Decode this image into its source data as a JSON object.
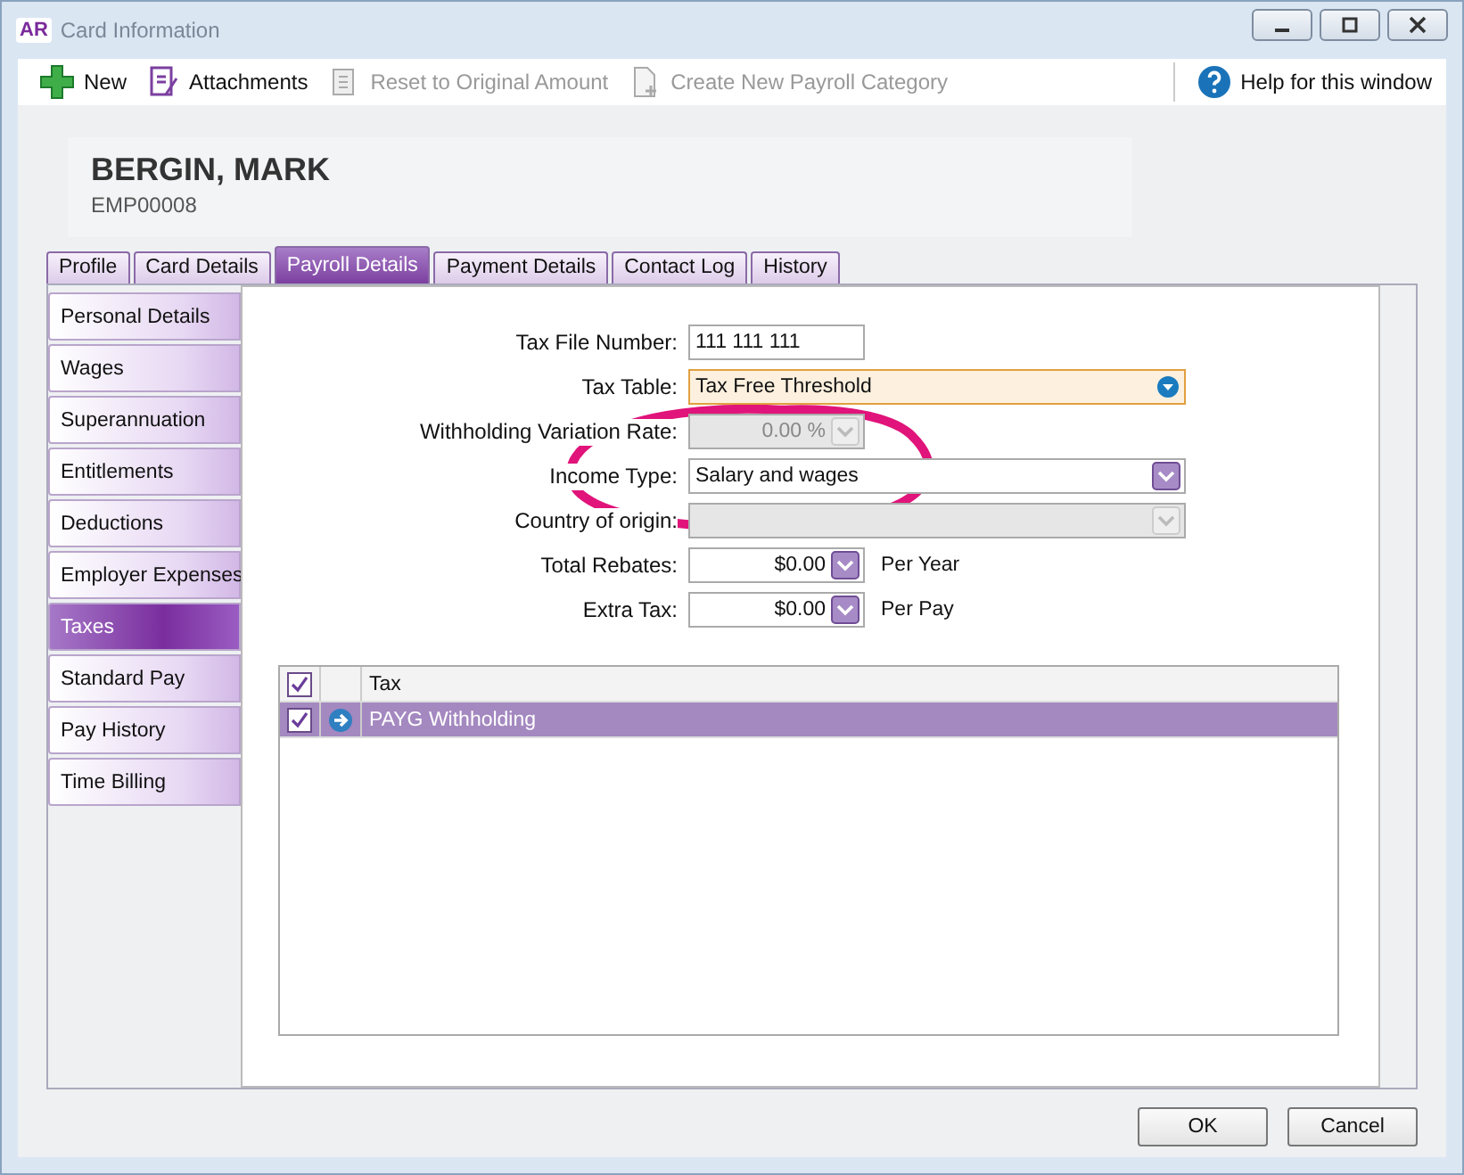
{
  "window": {
    "badge": "AR",
    "title": "Card Information"
  },
  "toolbar": [
    {
      "kind": "new",
      "label": "New",
      "disabled": false
    },
    {
      "kind": "attach",
      "label": "Attachments",
      "disabled": false
    },
    {
      "kind": "reset",
      "label": "Reset to Original Amount",
      "disabled": true
    },
    {
      "kind": "create",
      "label": "Create New Payroll Category",
      "disabled": true
    }
  ],
  "help": "Help for this window",
  "card": {
    "name": "BERGIN, MARK",
    "id": "EMP00008"
  },
  "tabs": [
    {
      "label": "Profile",
      "selected": false
    },
    {
      "label": "Card Details",
      "selected": false
    },
    {
      "label": "Payroll Details",
      "selected": true
    },
    {
      "label": "Payment Details",
      "selected": false
    },
    {
      "label": "Contact Log",
      "selected": false
    },
    {
      "label": "History",
      "selected": false
    }
  ],
  "sidebar": [
    {
      "label": "Personal Details",
      "selected": false
    },
    {
      "label": "Wages",
      "selected": false
    },
    {
      "label": "Superannuation",
      "selected": false
    },
    {
      "label": "Entitlements",
      "selected": false
    },
    {
      "label": "Deductions",
      "selected": false
    },
    {
      "label": "Employer Expenses",
      "selected": false
    },
    {
      "label": "Taxes",
      "selected": true
    },
    {
      "label": "Standard Pay",
      "selected": false
    },
    {
      "label": "Pay History",
      "selected": false
    },
    {
      "label": "Time Billing",
      "selected": false
    }
  ],
  "form": [
    {
      "kind": "text",
      "label": "Tax File Number:",
      "value": "111 111 111"
    },
    {
      "kind": "combo",
      "label": "Tax Table:",
      "value": "Tax Free Threshold",
      "focused": true,
      "disabled": false
    },
    {
      "kind": "amount",
      "label": "Withholding Variation Rate:",
      "value": "0.00 %",
      "disabled": true
    },
    {
      "kind": "combo",
      "label": "Income Type:",
      "value": "Salary and wages",
      "focused": false,
      "disabled": false
    },
    {
      "kind": "combo",
      "label": "Country of origin:",
      "focused": false,
      "disabled": true
    },
    {
      "kind": "amount",
      "label": "Total Rebates:",
      "value": "$0.00",
      "suffix": "Per Year",
      "disabled": false
    },
    {
      "kind": "amount",
      "label": "Extra Tax:",
      "value": "$0.00",
      "suffix": "Per Pay",
      "disabled": false
    }
  ],
  "table": {
    "header_checked": true,
    "columns": [
      "Tax"
    ],
    "rows": [
      {
        "checked": true,
        "label": "PAYG Withholding",
        "selected": true
      }
    ]
  },
  "buttons": [
    "OK",
    "Cancel"
  ]
}
